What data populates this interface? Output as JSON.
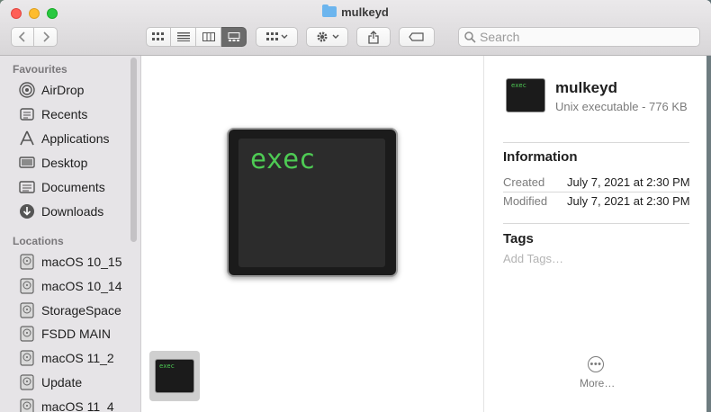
{
  "window": {
    "title": "mulkeyd"
  },
  "toolbar": {
    "search_placeholder": "Search",
    "icons": [
      "chevron-left-icon",
      "chevron-right-icon",
      "icon-view-icon",
      "list-view-icon",
      "column-view-icon",
      "gallery-view-icon",
      "group-icon",
      "gear-icon",
      "share-icon",
      "tag-icon",
      "search-icon"
    ]
  },
  "sidebar": {
    "favourites_header": "Favourites",
    "favourites": [
      {
        "label": "AirDrop",
        "icon": "airdrop-icon"
      },
      {
        "label": "Recents",
        "icon": "recents-icon"
      },
      {
        "label": "Applications",
        "icon": "applications-icon"
      },
      {
        "label": "Desktop",
        "icon": "desktop-icon"
      },
      {
        "label": "Documents",
        "icon": "documents-icon"
      },
      {
        "label": "Downloads",
        "icon": "downloads-icon"
      }
    ],
    "locations_header": "Locations",
    "locations": [
      {
        "label": "macOS 10_15",
        "icon": "disk-icon"
      },
      {
        "label": "macOS 10_14",
        "icon": "disk-icon"
      },
      {
        "label": "StorageSpace",
        "icon": "disk-icon"
      },
      {
        "label": "FSDD MAIN",
        "icon": "disk-icon"
      },
      {
        "label": "macOS 11_2",
        "icon": "disk-icon"
      },
      {
        "label": "Update",
        "icon": "disk-icon"
      },
      {
        "label": "macOS 11_4",
        "icon": "disk-icon"
      }
    ]
  },
  "preview": {
    "icon_text": "exec",
    "thumb_text": "exec"
  },
  "info": {
    "file_name": "mulkeyd",
    "kind": "Unix executable - 776 KB",
    "icon_text": "exec",
    "information_header": "Information",
    "created_label": "Created",
    "created_value": "July 7, 2021 at 2:30 PM",
    "modified_label": "Modified",
    "modified_value": "July 7, 2021 at 2:30 PM",
    "tags_header": "Tags",
    "add_tags": "Add Tags…",
    "more_label": "More…"
  }
}
